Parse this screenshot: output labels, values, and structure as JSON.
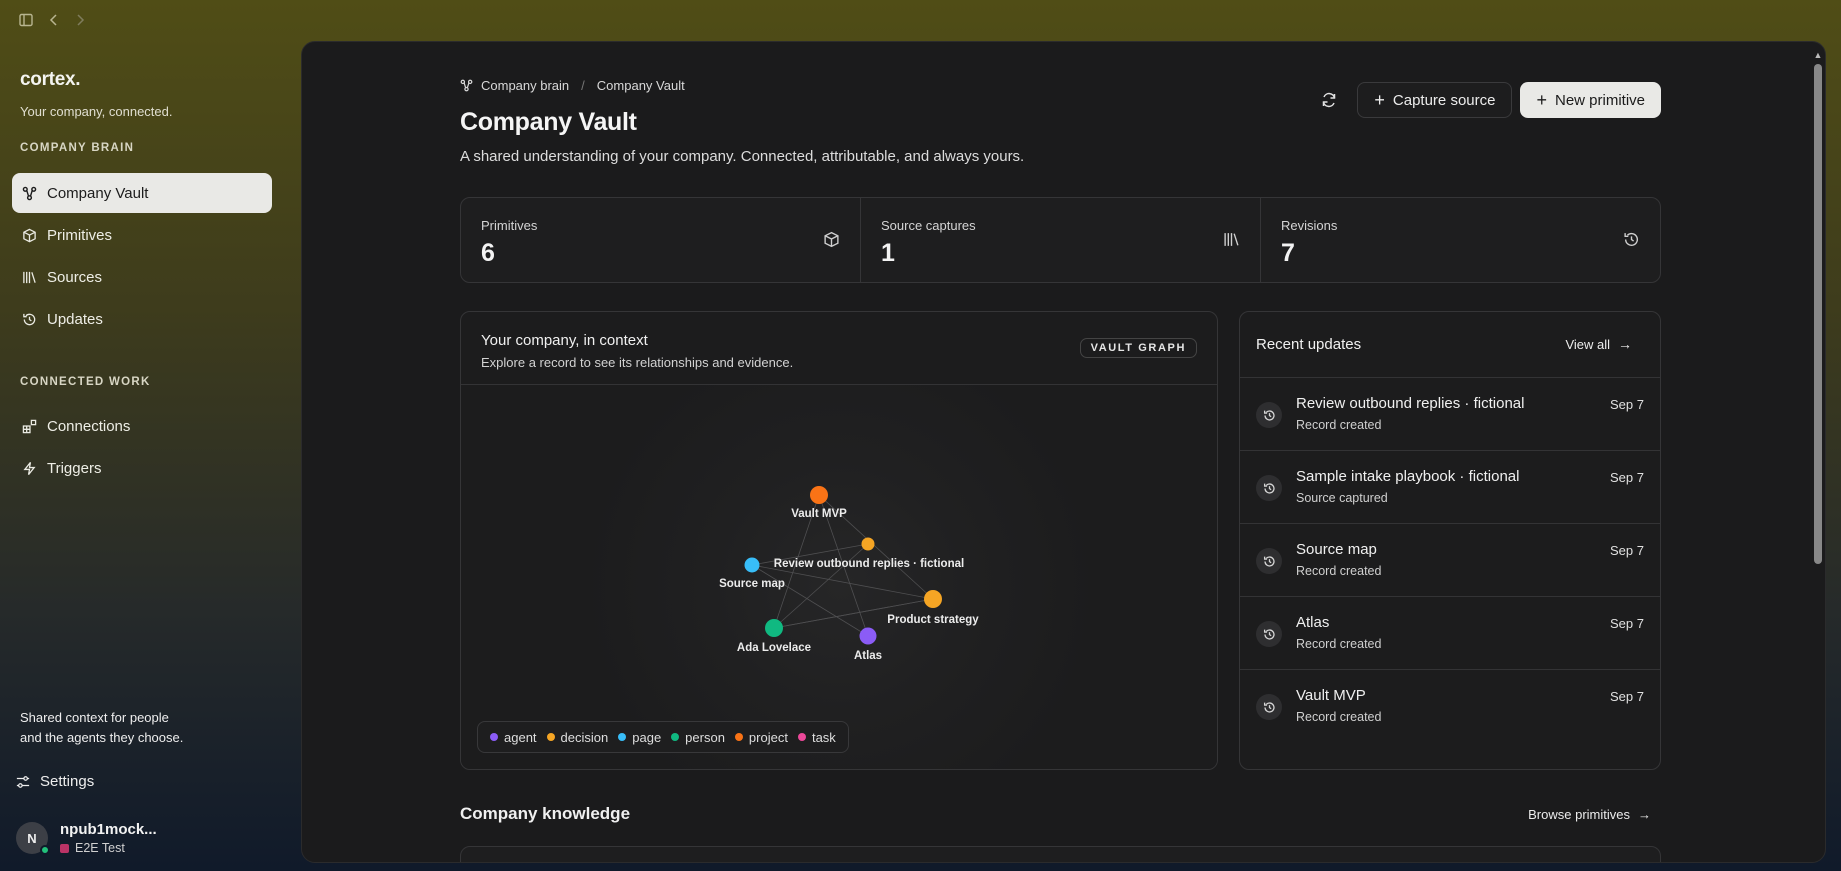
{
  "sidebar": {
    "brand": "cortex.",
    "tagline": "Your company, connected.",
    "section_company": "COMPANY BRAIN",
    "company_items": [
      {
        "label": "Company Vault",
        "icon": "graph-icon",
        "active": true
      },
      {
        "label": "Primitives",
        "icon": "cube-icon"
      },
      {
        "label": "Sources",
        "icon": "library-icon"
      },
      {
        "label": "Updates",
        "icon": "history-icon"
      }
    ],
    "section_connected": "CONNECTED WORK",
    "connected_items": [
      {
        "label": "Connections",
        "icon": "blocks-icon"
      },
      {
        "label": "Triggers",
        "icon": "bolt-icon"
      }
    ],
    "footnote_line1": "Shared context for people",
    "footnote_line2": "and the agents they choose.",
    "settings_label": "Settings",
    "user": {
      "initial": "N",
      "name": "npub1mock...",
      "org": "E2E Test"
    }
  },
  "header": {
    "breadcrumb": [
      "Company brain",
      "Company Vault"
    ],
    "title": "Company Vault",
    "subtitle": "A shared understanding of your company. Connected, attributable, and always yours.",
    "capture_label": "Capture source",
    "new_label": "New primitive"
  },
  "stats": [
    {
      "label": "Primitives",
      "value": "6",
      "icon": "cube-icon"
    },
    {
      "label": "Source captures",
      "value": "1",
      "icon": "library-icon"
    },
    {
      "label": "Revisions",
      "value": "7",
      "icon": "history-icon"
    }
  ],
  "graph": {
    "title": "Your company, in context",
    "description": "Explore a record to see its relationships and evidence.",
    "pill": "VAULT GRAPH",
    "nodes": [
      {
        "label": "Vault MVP",
        "type": "project"
      },
      {
        "label": "Review outbound replies · fictional",
        "type": "decision"
      },
      {
        "label": "Source map",
        "type": "page"
      },
      {
        "label": "Product strategy",
        "type": "decision"
      },
      {
        "label": "Ada Lovelace",
        "type": "person"
      },
      {
        "label": "Atlas",
        "type": "agent"
      }
    ],
    "legend": [
      {
        "label": "agent",
        "color": "#8b5cf6"
      },
      {
        "label": "decision",
        "color": "#f5a524"
      },
      {
        "label": "page",
        "color": "#38bdf8"
      },
      {
        "label": "person",
        "color": "#10b981"
      },
      {
        "label": "project",
        "color": "#f97316"
      },
      {
        "label": "task",
        "color": "#ec4899"
      }
    ]
  },
  "updates": {
    "title": "Recent updates",
    "view_all": "View all",
    "items": [
      {
        "title": "Review outbound replies · fictional",
        "sub": "Record created",
        "date": "Sep 7"
      },
      {
        "title": "Sample intake playbook · fictional",
        "sub": "Source captured",
        "date": "Sep 7"
      },
      {
        "title": "Source map",
        "sub": "Record created",
        "date": "Sep 7"
      },
      {
        "title": "Atlas",
        "sub": "Record created",
        "date": "Sep 7"
      },
      {
        "title": "Vault MVP",
        "sub": "Record created",
        "date": "Sep 7"
      }
    ]
  },
  "knowledge": {
    "title": "Company knowledge",
    "browse": "Browse primitives"
  }
}
